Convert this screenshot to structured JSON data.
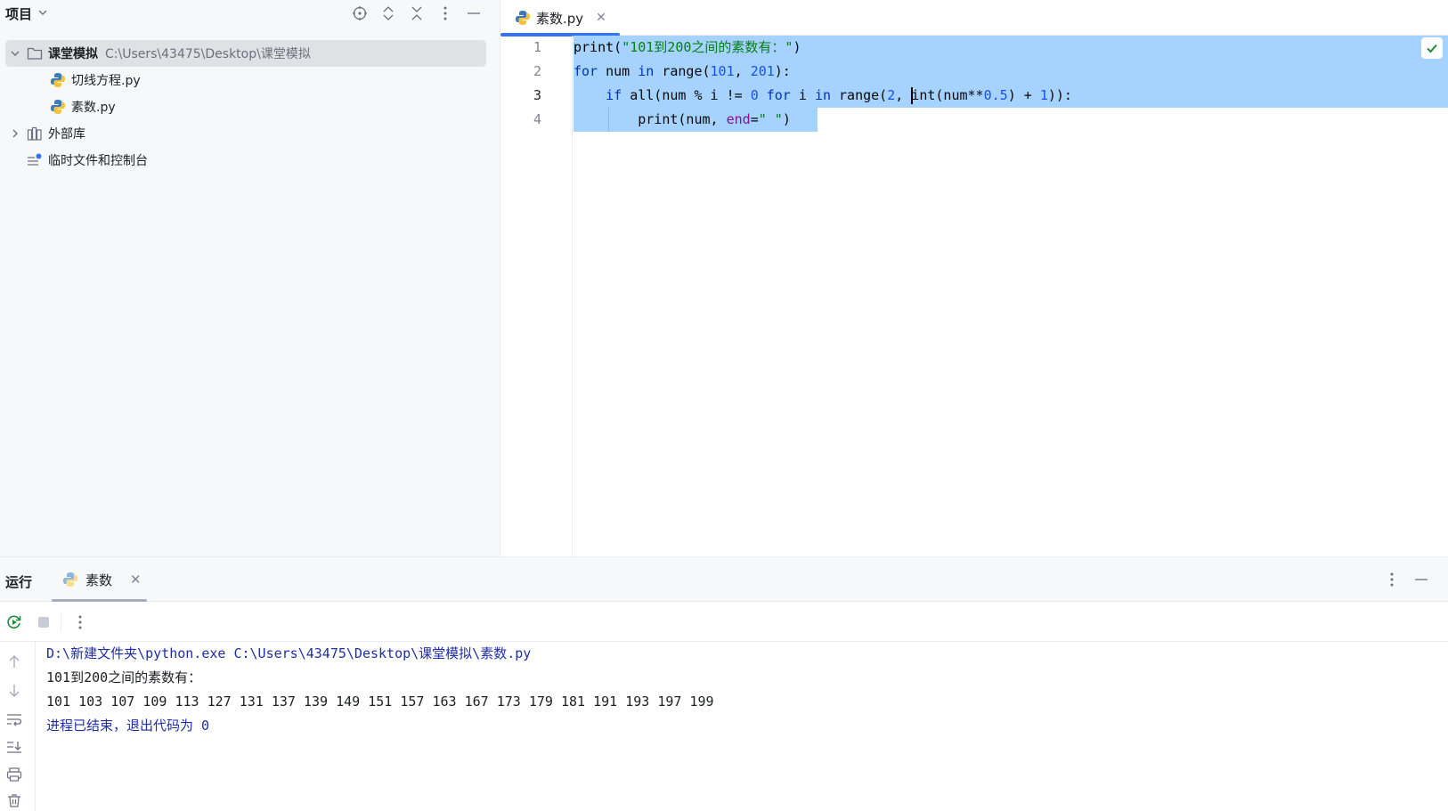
{
  "project_panel": {
    "title": "项目",
    "tree": [
      {
        "label": "课堂模拟",
        "path": "C:\\Users\\43475\\Desktop\\课堂模拟"
      },
      {
        "label": "切线方程.py"
      },
      {
        "label": "素数.py"
      },
      {
        "label": "外部库"
      },
      {
        "label": "临时文件和控制台"
      }
    ],
    "header_icons": [
      "locate-icon",
      "expand-all-icon",
      "collapse-all-icon",
      "more-options-icon",
      "minimize-icon"
    ]
  },
  "editor": {
    "tab": {
      "label": "素数.py"
    },
    "line_numbers": [
      "1",
      "2",
      "3",
      "4"
    ],
    "current_line": "3",
    "code": [
      "print(\"101到200之间的素数有：\")",
      "for num in range(101, 201):",
      "    if all(num % i != 0 for i in range(2, int(num**0.5) + 1)):",
      "        print(num, end=\" \")"
    ],
    "inspection_status": "check-icon"
  },
  "run_panel": {
    "title": "运行",
    "tab": {
      "label": "素数"
    },
    "console": [
      "D:\\新建文件夹\\python.exe C:\\Users\\43475\\Desktop\\课堂模拟\\素数.py",
      "101到200之间的素数有：",
      "101 103 107 109 113 127 131 137 139 149 151 157 163 167 173 179 181 191 193 197 199",
      "进程已结束，退出代码为 0"
    ]
  },
  "colors": {
    "accent": "#3574f0",
    "selection": "#a6d2ff",
    "keyword": "#0033b3",
    "string": "#067d17",
    "number": "#1750eb",
    "param": "#871094",
    "console_system": "#1f2ea5"
  }
}
